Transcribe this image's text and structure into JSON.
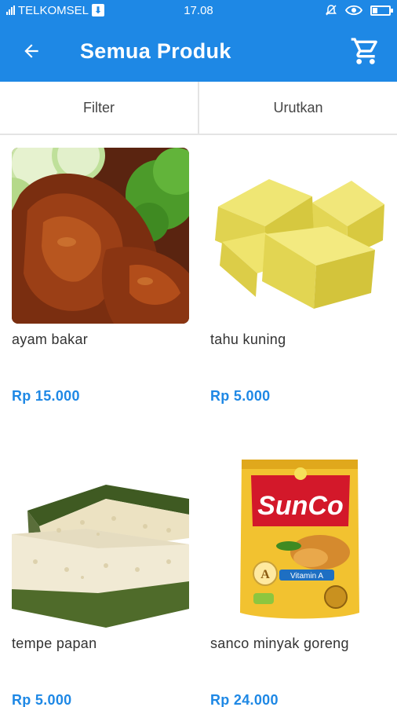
{
  "status_bar": {
    "carrier": "TELKOMSEL",
    "time": "17.08"
  },
  "app_bar": {
    "title": "Semua Produk",
    "back_icon": "arrow-left-icon",
    "cart_icon": "shopping-cart-icon"
  },
  "filter_bar": {
    "filter_label": "Filter",
    "sort_label": "Urutkan"
  },
  "products": [
    {
      "name": "ayam bakar",
      "price": "Rp 15.000",
      "image": "grilled-chicken-image"
    },
    {
      "name": "tahu kuning",
      "price": "Rp 5.000",
      "image": "yellow-tofu-image"
    },
    {
      "name": "tempe papan",
      "price": "Rp 5.000",
      "image": "tempeh-image"
    },
    {
      "name": "sanco minyak goreng",
      "price": "Rp 24.000",
      "image": "cooking-oil-pouch-image",
      "image_text": {
        "brand": "SunCo",
        "label": "Vitamin A",
        "mark": "A"
      }
    }
  ],
  "colors": {
    "primary": "#1e88e5",
    "price": "#1e88e5"
  }
}
